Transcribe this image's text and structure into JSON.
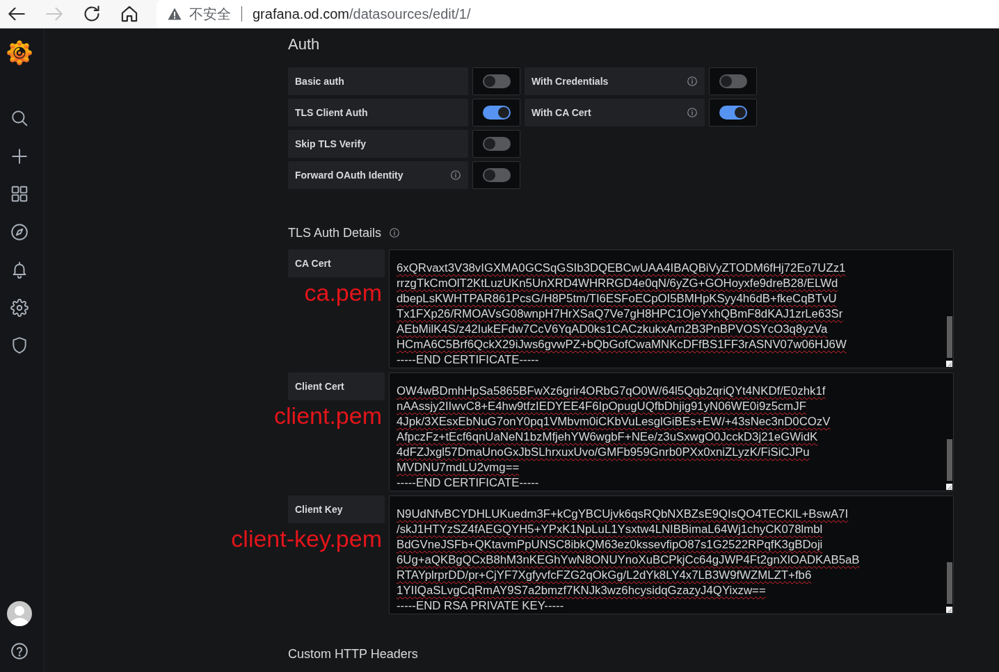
{
  "browser": {
    "nav_buttons": [
      {
        "kind": "back",
        "disabled": false
      },
      {
        "kind": "forward",
        "disabled": true
      },
      {
        "kind": "reload",
        "disabled": false
      },
      {
        "kind": "home",
        "disabled": false
      }
    ],
    "address": {
      "security_label": "不安全",
      "host": "grafana.od.com",
      "path": "/datasources/edit/1/"
    }
  },
  "auth": {
    "title": "Auth",
    "rows": [
      {
        "fields": [
          {
            "label": "Basic auth",
            "info": false,
            "on": false
          },
          {
            "label": "With Credentials",
            "info": true,
            "on": false
          }
        ]
      },
      {
        "fields": [
          {
            "label": "TLS Client Auth",
            "info": false,
            "on": true
          },
          {
            "label": "With CA Cert",
            "info": true,
            "on": true
          }
        ]
      },
      {
        "fields": [
          {
            "label": "Skip TLS Verify",
            "info": false,
            "on": false
          }
        ]
      },
      {
        "fields": [
          {
            "label": "Forward OAuth Identity",
            "info": true,
            "on": false
          }
        ]
      }
    ]
  },
  "tls_auth_details": {
    "title": "TLS Auth Details",
    "info": true,
    "fields": [
      {
        "label": "CA Cert",
        "annotation": "ca.pem",
        "lines": [
          "6xQRvaxt3V38vIGXMA0GCSqGSIb3DQEBCwUAA4IBAQBiVyZTODM6fHj72Eo7UZz1",
          "rrzgTkCmOlT2KtLuzUKn5UnXRD4WHRRGD4e0qN/6yZG+GOHoyxfe9dreB28/ELWd",
          "dbepLsKWHTPAR861PcsG/H8P5tm/TI6ESFoECpOI5BMHpKSyy4h6dB+fkeCqBTvU",
          "Tx1FXp26/RMOAVsG08wnpH7HrXSaQ7Ve7gH8HPC1OjeYxhQBmF8dKAJ1zrLe63Sr",
          "AEbMilK4S/z42IukEFdw7CcV6YqAD0ks1CACzkukxArn2B3PnBPVOSYcO3q8yzVa",
          "HCmA6C5Brf6QckX29iJws6gvwPZ+bQbGofCwaMNKcDFfBS1FF3rASNV07w06HJ6W"
        ],
        "end_line": "-----END CERTIFICATE-----"
      },
      {
        "label": "Client Cert",
        "annotation": "client.pem",
        "lines": [
          "OW4wBDmhHpSa5865BFwXz6grir4ORbG7qO0W/64l5Qqb2qriQYt4NKDf/E0zhk1f",
          "nAAssjy2IIwvC8+E4hw9tfzIEDYEE4F6IpOpugUQfbDhjig91yN06WE0i9z5cmJF",
          "4Jpk/3XEsxEbNuG7onY0pq1VMbvm0iCKbVuLesglGiBEs+EW/+43sNec3nD0COzV",
          "AfpczFz+tEcf6qnUaNeN1bzMfjehYW6wgbF+NEe/z3uSxwgO0JcckD3j21eGWidK",
          "4dFZJxgl57DmaUnoGxJbSLhrxuxUvo/GMFb959Gnrb0PXx0xniZLyzK/FiSiCJPu",
          "MVDNU7mdLU2vmg=="
        ],
        "end_line": "-----END CERTIFICATE-----"
      },
      {
        "label": "Client Key",
        "annotation": "client-key.pem",
        "lines": [
          "N9UdNfvBCYDHLUKuedm3F+kCgYBCUjvk6qsRQbNXBZsE9QIsQO4TECKlL+BswA7I",
          "/skJ1HTYzSZ4fAEGQYH5+YPxK1NpLuL1Ysxtw4LNIBBimaL64Wj1chyCK078lmbl",
          "BdGVneJSFb+QKtavmPpUNSC8ibkQM63ez0kssevfipO87s1G2522RPqfK3gBDoji",
          "6Ug+aQKBgQCxB8hM3nKEGhYwN8ONUYnoXuBCPkjCc64gJWP4Ft2gnXlOADKAB5aB",
          "RTAYplrprDD/pr+CjYF7XgfyvfcFZG2qOkGg/L2dYk8LY4x7LB3W9fWZMLZT+fb6",
          "1YIIQaSLvgCqRmAY9S7a2bmzf7KNJk3wz6hcysidqGzazyJ4QYixzw=="
        ],
        "end_line": "-----END RSA PRIVATE KEY-----"
      }
    ]
  },
  "custom_http_headers": {
    "title": "Custom HTTP Headers"
  }
}
